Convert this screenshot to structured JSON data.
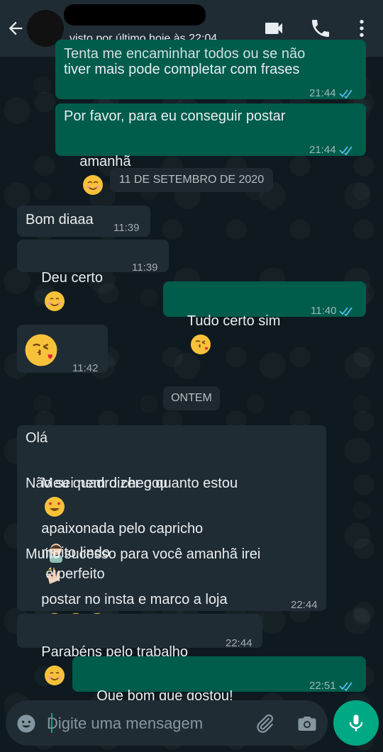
{
  "header": {
    "last_seen": "visto por último hoje às 22:04"
  },
  "messages": [
    {
      "dir": "out",
      "lines": [
        "Tenta me encaminhar todos ou se não",
        "tiver mais pode completar com frases"
      ],
      "time": "21:44"
    },
    {
      "dir": "out",
      "lines": [
        "Por favor, para eu conseguir postar",
        "amanhã"
      ],
      "time": "21:44"
    },
    {
      "date": "11 DE SETEMBRO DE 2020"
    },
    {
      "dir": "in",
      "lines": [
        "Bom diaaa"
      ],
      "time": "11:39"
    },
    {
      "dir": "in",
      "lines": [
        "Deu certo"
      ],
      "time": "11:39"
    },
    {
      "dir": "out",
      "lines": [
        "Tudo certo sim"
      ],
      "time": "11:40"
    },
    {
      "dir": "in",
      "lines": [
        ""
      ],
      "time": "11:42"
    },
    {
      "date": "ONTEM"
    },
    {
      "dir": "in",
      "lines": [
        "Olá",
        "Meu quadro chegou",
        "Não sei nem dizer o quanto estou",
        "apaixonada pelo capricho",
        "é perfeito",
        "muito lindo",
        "Muito sucesso para você amanhã irei",
        "postar no insta e marco a loja"
      ],
      "time": "22:44"
    },
    {
      "dir": "in",
      "lines": [
        "Parabéns pelo trabalho"
      ],
      "time": "22:44"
    },
    {
      "dir": "out",
      "lines": [
        "Que bom que gostou!"
      ],
      "time": "22:51"
    }
  ],
  "input": {
    "placeholder": "Digite uma mensagem"
  },
  "colors": {
    "header": "#1f2c34",
    "outgoing_bubble": "#005c4b",
    "incoming_bubble": "#1f2c34",
    "accent": "#00a884",
    "read_tick": "#53bdeb"
  },
  "icons": [
    "back-arrow-icon",
    "video-call-icon",
    "phone-icon",
    "more-vert-icon",
    "emoji-icon",
    "attach-icon",
    "camera-icon",
    "mic-icon",
    "double-check-icon"
  ]
}
